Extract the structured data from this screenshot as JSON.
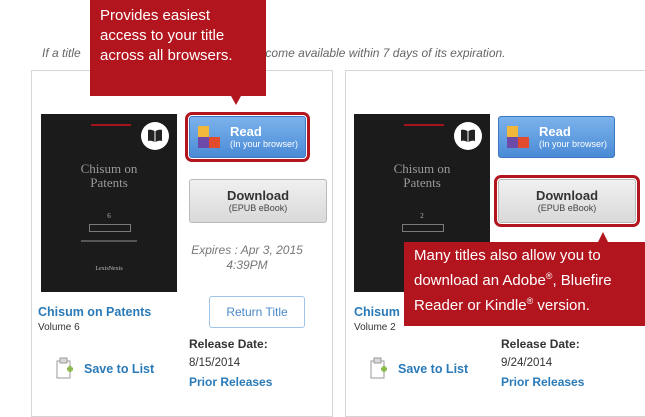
{
  "notice": {
    "prefix": "If a title",
    "suffix": "on will become available within 7 days of its expiration."
  },
  "callouts": {
    "read": "Provides easiest access to your title across all browsers.",
    "download_1": "Many titles also allow you to download an Adobe",
    "download_2": ", Bluefire Reader or Kindle",
    "download_3": " version.",
    "registered": "®"
  },
  "books": [
    {
      "cover_title": "Chisum on Patents",
      "cover_volume": "6",
      "cover_publisher": "LexisNexis",
      "read_label": "Read",
      "read_sub": "(In your browser)",
      "download_label": "Download",
      "download_sub": "(EPUB eBook)",
      "expires_line1": "Expires :  Apr 3, 2015",
      "expires_line2": "4:39PM",
      "return_label": "Return Title",
      "title": "Chisum on Patents",
      "volume": "Volume 6",
      "save_label": "Save to List",
      "release_label": "Release Date:",
      "release_date": "8/15/2014",
      "prior_label": "Prior Releases"
    },
    {
      "cover_title": "Chisum on Patents",
      "cover_volume": "2",
      "read_label": "Read",
      "read_sub": "(In your browser)",
      "download_label": "Download",
      "download_sub": "(EPUB eBook)",
      "title": "Chisum",
      "volume": "Volume 2",
      "save_label": "Save to List",
      "release_label": "Release Date:",
      "release_date": "9/24/2014",
      "prior_label": "Prior Releases"
    }
  ],
  "colors": {
    "callout": "#b3151f",
    "link": "#2a7ab8",
    "read_button": "#4a8bd6"
  },
  "icons": [
    "book-icon",
    "read-squares-icon",
    "save-to-list-icon"
  ]
}
